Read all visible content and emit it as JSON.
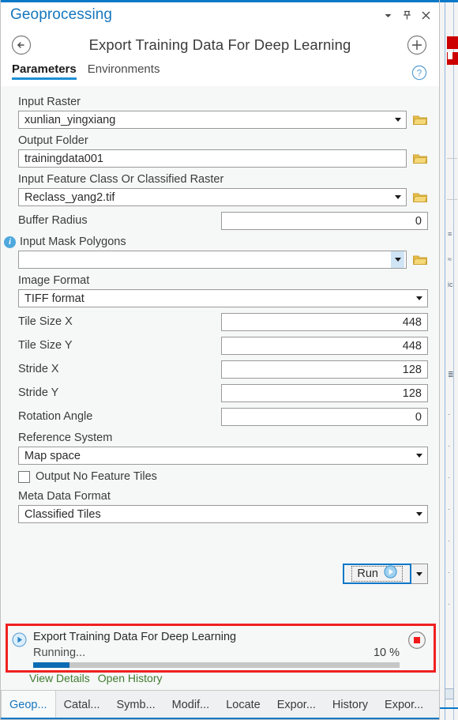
{
  "colors": {
    "accent": "#0a78c8",
    "title_blue": "#1676bd",
    "progress_fill": "#0b6cb3",
    "annotation_red": "#f02020",
    "link_green": "#3f7d2f",
    "info_blue": "#4ea8dd",
    "folder_gold": "#e8bf48",
    "stop_red": "#f01818",
    "highlight_blue": "#cfe4f5"
  },
  "titlebar": {
    "title": "Geoprocessing",
    "menu_icon": "chevron-down-icon",
    "pin_icon": "pin-icon",
    "close_icon": "close-icon"
  },
  "toolheader": {
    "back_icon": "back-arrow-icon",
    "tool_title": "Export Training Data For Deep Learning",
    "add_icon": "plus-icon"
  },
  "tabs": {
    "items": [
      {
        "label": "Parameters",
        "active": true
      },
      {
        "label": "Environments",
        "active": false
      }
    ],
    "help_icon": "help-icon"
  },
  "parameters": [
    {
      "id": "input-raster",
      "label": "Input Raster",
      "value": "xunlian_yingxiang",
      "placeholder": "",
      "control": "combobox",
      "layout": "stacked",
      "has_folder": true,
      "caret_highlight": false
    },
    {
      "id": "output-folder",
      "label": "Output Folder",
      "value": "trainingdata001",
      "placeholder": "",
      "control": "text",
      "layout": "stacked",
      "has_folder": true,
      "caret_highlight": false
    },
    {
      "id": "input-feature-class",
      "label": "Input Feature Class Or Classified Raster",
      "value": "Reclass_yang2.tif",
      "placeholder": "",
      "control": "combobox",
      "layout": "stacked",
      "has_folder": true,
      "caret_highlight": false
    },
    {
      "id": "buffer-radius",
      "label": "Buffer Radius",
      "value": "0",
      "placeholder": "",
      "control": "number",
      "layout": "inline",
      "has_folder": false,
      "caret_highlight": false
    },
    {
      "id": "input-mask-polygons",
      "label": "Input Mask Polygons",
      "value": "",
      "placeholder": "",
      "control": "combobox",
      "layout": "stacked",
      "has_folder": true,
      "has_info": true,
      "info_icon": "info-icon",
      "caret_highlight": true
    },
    {
      "id": "image-format",
      "label": "Image Format",
      "value": "TIFF format",
      "placeholder": "",
      "control": "select",
      "layout": "stacked",
      "has_folder": false,
      "caret_highlight": false
    },
    {
      "id": "tile-size-x",
      "label": "Tile Size X",
      "value": "448",
      "placeholder": "",
      "control": "number",
      "layout": "inline",
      "has_folder": false,
      "caret_highlight": false
    },
    {
      "id": "tile-size-y",
      "label": "Tile Size Y",
      "value": "448",
      "placeholder": "",
      "control": "number",
      "layout": "inline",
      "has_folder": false,
      "caret_highlight": false
    },
    {
      "id": "stride-x",
      "label": "Stride X",
      "value": "128",
      "placeholder": "",
      "control": "number",
      "layout": "inline",
      "has_folder": false,
      "caret_highlight": false
    },
    {
      "id": "stride-y",
      "label": "Stride Y",
      "value": "128",
      "placeholder": "",
      "control": "number",
      "layout": "inline",
      "has_folder": false,
      "caret_highlight": false
    },
    {
      "id": "rotation-angle",
      "label": "Rotation Angle",
      "value": "0",
      "placeholder": "",
      "control": "number",
      "layout": "inline",
      "has_folder": false,
      "caret_highlight": false
    },
    {
      "id": "reference-system",
      "label": "Reference System",
      "value": "Map space",
      "placeholder": "",
      "control": "select",
      "layout": "stacked",
      "has_folder": false,
      "caret_highlight": false
    }
  ],
  "checkbox": {
    "label": "Output No Feature Tiles",
    "checked": false
  },
  "metadata_format": {
    "label": "Meta Data Format",
    "value": "Classified Tiles",
    "control": "select"
  },
  "run": {
    "label": "Run",
    "run_icon": "play-icon",
    "dropdown_icon": "chevron-down-icon",
    "focused": true
  },
  "status": {
    "play_icon": "play-circle-icon",
    "title": "Export Training Data For Deep Learning",
    "state_text": "Running...",
    "percent_text": "10 %",
    "percent_value": 10,
    "stop_icon": "stop-icon",
    "links": [
      {
        "label": "View Details"
      },
      {
        "label": "Open History"
      }
    ]
  },
  "bottom_tabs": [
    {
      "label": "Geop...",
      "active": true
    },
    {
      "label": "Catal...",
      "active": false
    },
    {
      "label": "Symb...",
      "active": false
    },
    {
      "label": "Modif...",
      "active": false
    },
    {
      "label": "Locate",
      "active": false
    },
    {
      "label": "Expor...",
      "active": false
    },
    {
      "label": "History",
      "active": false
    },
    {
      "label": "Expor...",
      "active": false
    }
  ]
}
